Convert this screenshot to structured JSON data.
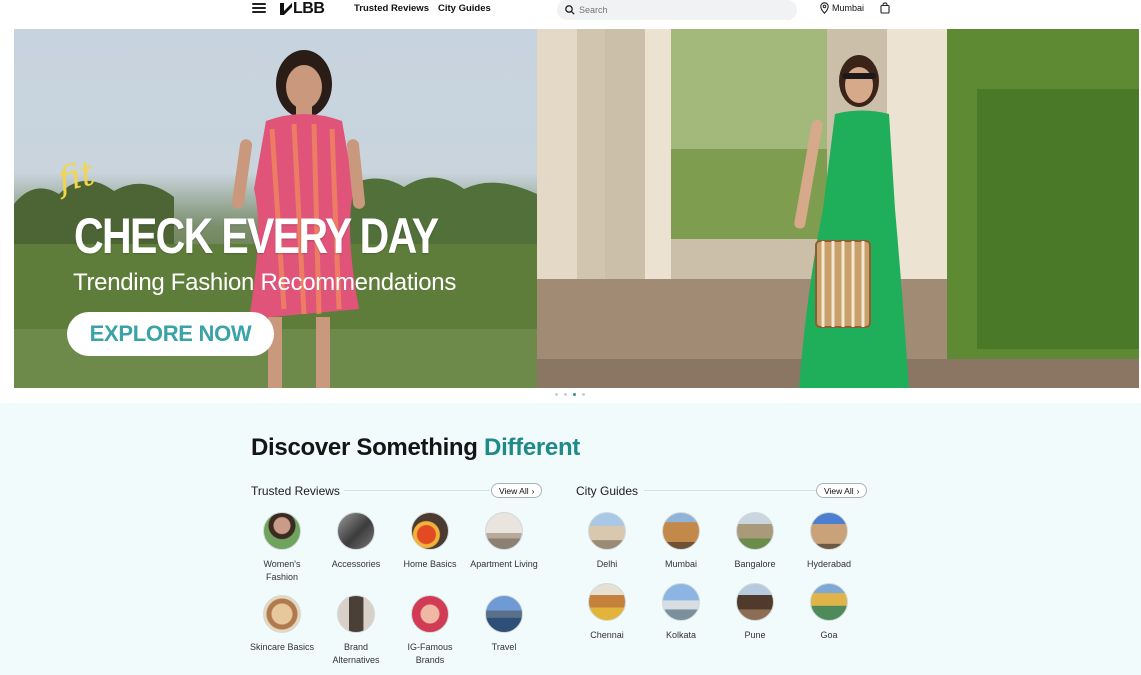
{
  "header": {
    "brand": "LBB",
    "nav": [
      "Trusted Reviews",
      "City Guides"
    ],
    "search_placeholder": "Search",
    "location": "Mumbai"
  },
  "hero": {
    "script_text": "fit",
    "title": "CHECK EVERY DAY",
    "subtitle": "Trending Fashion Recommendations",
    "cta": "EXPLORE NOW",
    "slide_count": 4,
    "active_slide": 3
  },
  "discover": {
    "title_prefix": "Discover Something",
    "title_accent": "Different",
    "accent_color": "#1f8a87"
  },
  "trusted_reviews": {
    "title": "Trusted Reviews",
    "view_all": "View All",
    "items": [
      {
        "label": "Women's Fashion"
      },
      {
        "label": "Accessories"
      },
      {
        "label": "Home Basics"
      },
      {
        "label": "Apartment Living"
      },
      {
        "label": "Skincare Basics"
      },
      {
        "label": "Brand Alternatives"
      },
      {
        "label": "IG-Famous Brands"
      },
      {
        "label": "Travel"
      }
    ]
  },
  "city_guides": {
    "title": "City Guides",
    "view_all": "View All",
    "items": [
      {
        "label": "Delhi"
      },
      {
        "label": "Mumbai"
      },
      {
        "label": "Bangalore"
      },
      {
        "label": "Hyderabad"
      },
      {
        "label": "Chennai"
      },
      {
        "label": "Kolkata"
      },
      {
        "label": "Pune"
      },
      {
        "label": "Goa"
      }
    ]
  }
}
